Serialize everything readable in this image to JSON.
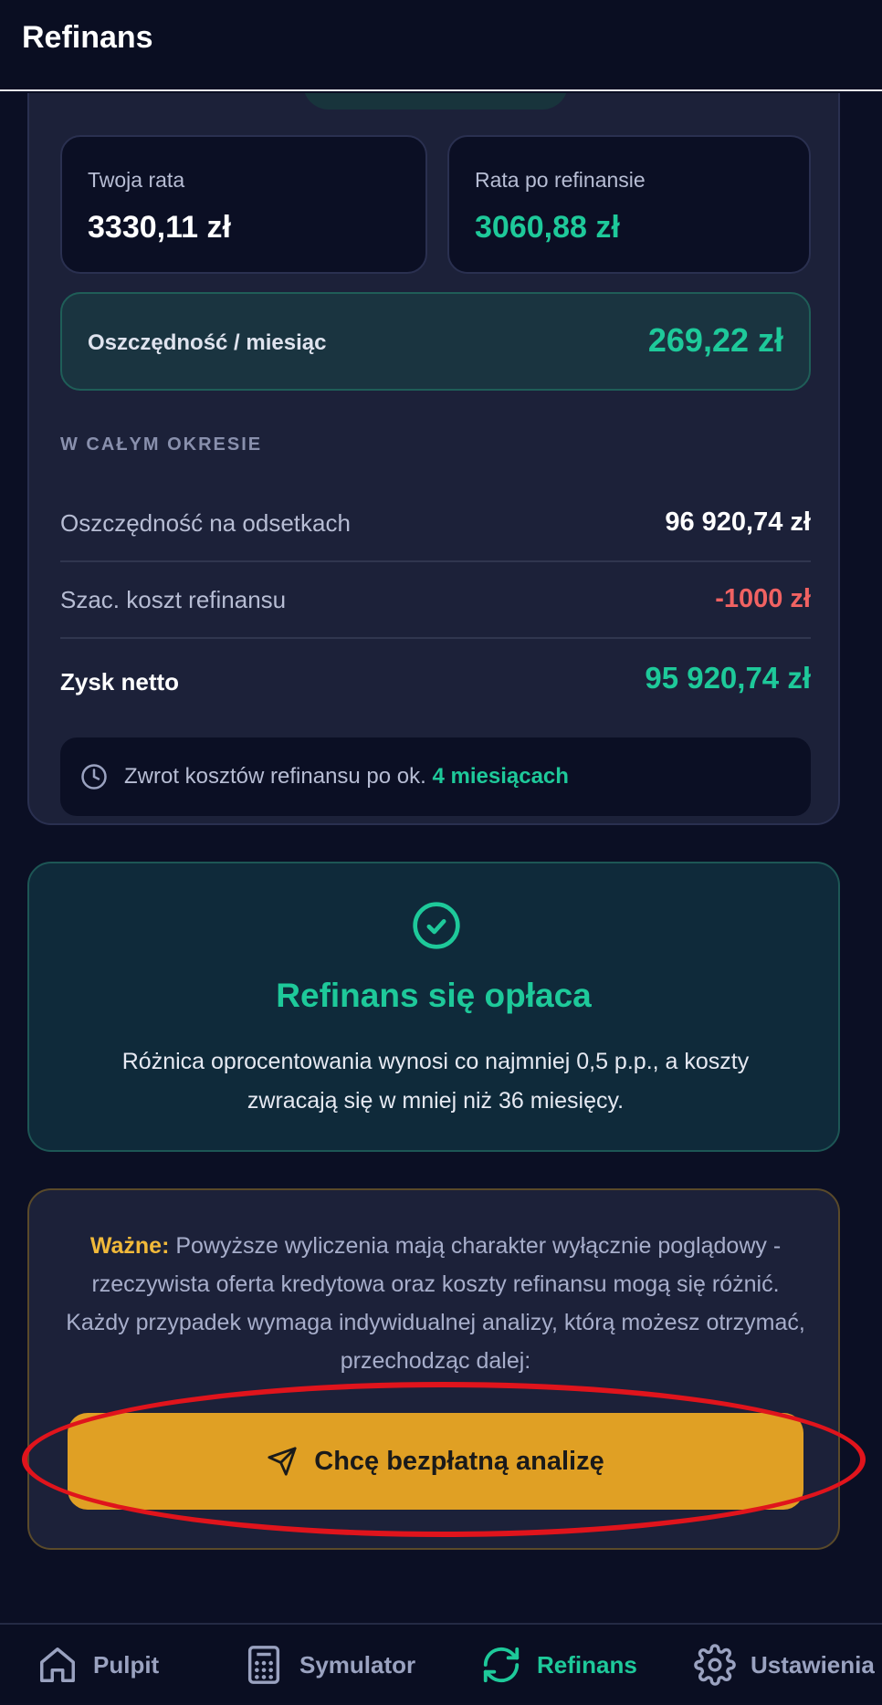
{
  "header": {
    "title": "Refinans"
  },
  "rates": {
    "current_label": "Twoja rata",
    "current_value": "3330,11 zł",
    "after_label": "Rata po refinansie",
    "after_value": "3060,88 zł"
  },
  "monthly_savings": {
    "label": "Oszczędność / miesiąc",
    "value": "269,22 zł"
  },
  "period": {
    "heading": "W CAŁYM OKRESIE",
    "rows": [
      {
        "label": "Oszczędność na odsetkach",
        "value": "96 920,74 zł"
      },
      {
        "label": "Szac. koszt refinansu",
        "value": "-1000 zł"
      },
      {
        "label": "Zysk netto",
        "value": "95 920,74 zł"
      }
    ]
  },
  "payback": {
    "text": "Zwrot kosztów refinansu po ok.",
    "highlight": "4 miesiącach",
    "icon": "clock-icon"
  },
  "verdict": {
    "icon": "check-circle-icon",
    "title": "Refinans się opłaca",
    "description": "Różnica oprocentowania wynosi co najmniej 0,5 p.p., a koszty zwracają się w mniej niż 36 miesięcy."
  },
  "important": {
    "label": "Ważne:",
    "text": "Powyższe wyliczenia mają charakter wyłącznie poglądowy - rzeczywista oferta kredytowa oraz koszty refinansu mogą się różnić. Każdy przypadek wymaga indywidualnej analizy, którą możesz otrzymać, przechodząc dalej:",
    "cta_label": "Chcę bezpłatną analizę",
    "cta_icon": "send-icon"
  },
  "nav": {
    "items": [
      {
        "label": "Pulpit",
        "icon": "home-icon",
        "active": false
      },
      {
        "label": "Symulator",
        "icon": "calculator-icon",
        "active": false
      },
      {
        "label": "Refinans",
        "icon": "refresh-icon",
        "active": true
      },
      {
        "label": "Ustawienia",
        "icon": "gear-icon",
        "active": false
      }
    ]
  },
  "colors": {
    "background": "#0b0f24",
    "card": "#1c2139",
    "accent_green": "#1ec99a",
    "negative_red": "#f06262",
    "cta_yellow": "#e0a024",
    "highlight_ring": "#e0141c"
  }
}
